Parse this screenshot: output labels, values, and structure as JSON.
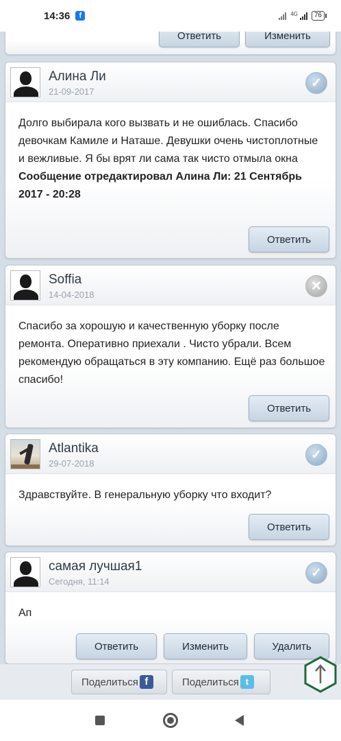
{
  "status_bar": {
    "time": "14:36",
    "app_badge": "f",
    "network_label": "4G",
    "battery": "76"
  },
  "top_card": {
    "reply_label": "Ответить",
    "edit_label": "Изменить"
  },
  "comments": [
    {
      "author": "Алина Ли",
      "date": "21-09-2017",
      "status_icon": "check-icon",
      "text": "Долго выбирала кого вызвать и не ошиблась. Спасибо девочкам Камиле и Наташе. Девушки очень чистоплотные и вежливые. Я бы врят ли сама так чисто отмыла окна",
      "edit_note": "Сообщение отредактировал Алина Ли: 21 Сентябрь 2017 - 20:28",
      "reply_label": "Ответить"
    },
    {
      "author": "Soffia",
      "date": "14-04-2018",
      "status_icon": "cross-icon",
      "text": "Спасибо за хорошую и качественную уборку после ремонта. Оперативно приехали . Чисто убрали. Всем рекомендую обращаться в эту компанию. Ещё раз большое спасибо!",
      "reply_label": "Ответить"
    },
    {
      "author": "Atlantika",
      "date": "29-07-2018",
      "status_icon": "check-icon",
      "text": "Здравствуйте. В генеральную уборку что входит?",
      "reply_label": "Ответить"
    },
    {
      "author": "самая лучшая1",
      "date": "Сегодня, 11:14",
      "status_icon": "check-icon",
      "text": "Ап",
      "reply_label": "Ответить",
      "edit_label": "Изменить",
      "delete_label": "Удалить"
    }
  ],
  "share": {
    "facebook_label": "Поделиться",
    "facebook_icon": "f",
    "twitter_label": "Поделиться",
    "twitter_icon": "t"
  },
  "scroll_top": {
    "icon": "arrow-up-icon",
    "color": "#1e6b3c"
  },
  "colors": {
    "page_bg": "#d5dde6",
    "button_top": "#e4ecf4",
    "button_bottom": "#c7d4e2",
    "check_icon": "#8ba8c4"
  }
}
